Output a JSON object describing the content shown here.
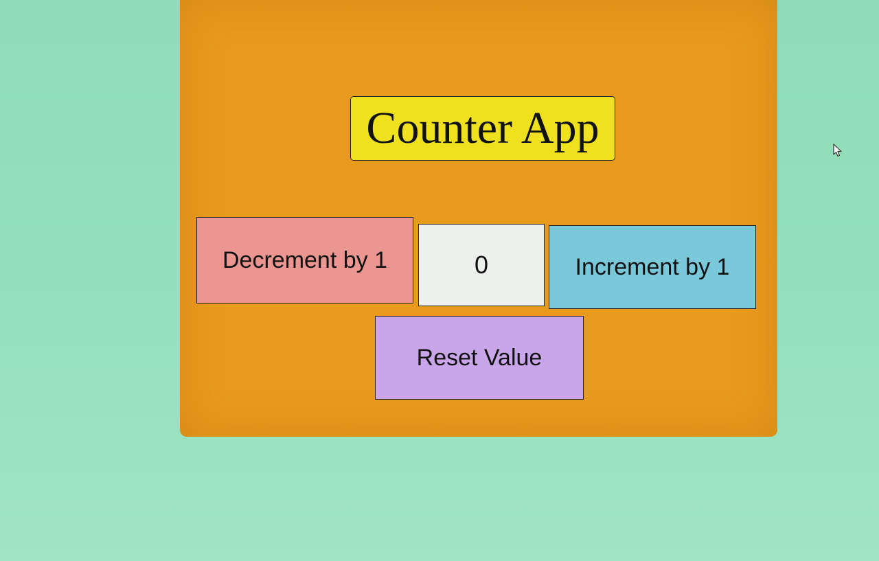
{
  "app": {
    "title": "Counter App",
    "counter_value": "0"
  },
  "buttons": {
    "decrement_label": "Decrement by 1",
    "increment_label": "Increment by 1",
    "reset_label": "Reset Value"
  },
  "colors": {
    "page_background": "#93e0bb",
    "card_background": "#e89a1c",
    "title_background": "#f0e11f",
    "decrement_background": "#ec9691",
    "counter_background": "#eef0ee",
    "increment_background": "#79c9db",
    "reset_background": "#c9a6e9"
  },
  "icons": {
    "cursor": "mouse-pointer-icon"
  }
}
